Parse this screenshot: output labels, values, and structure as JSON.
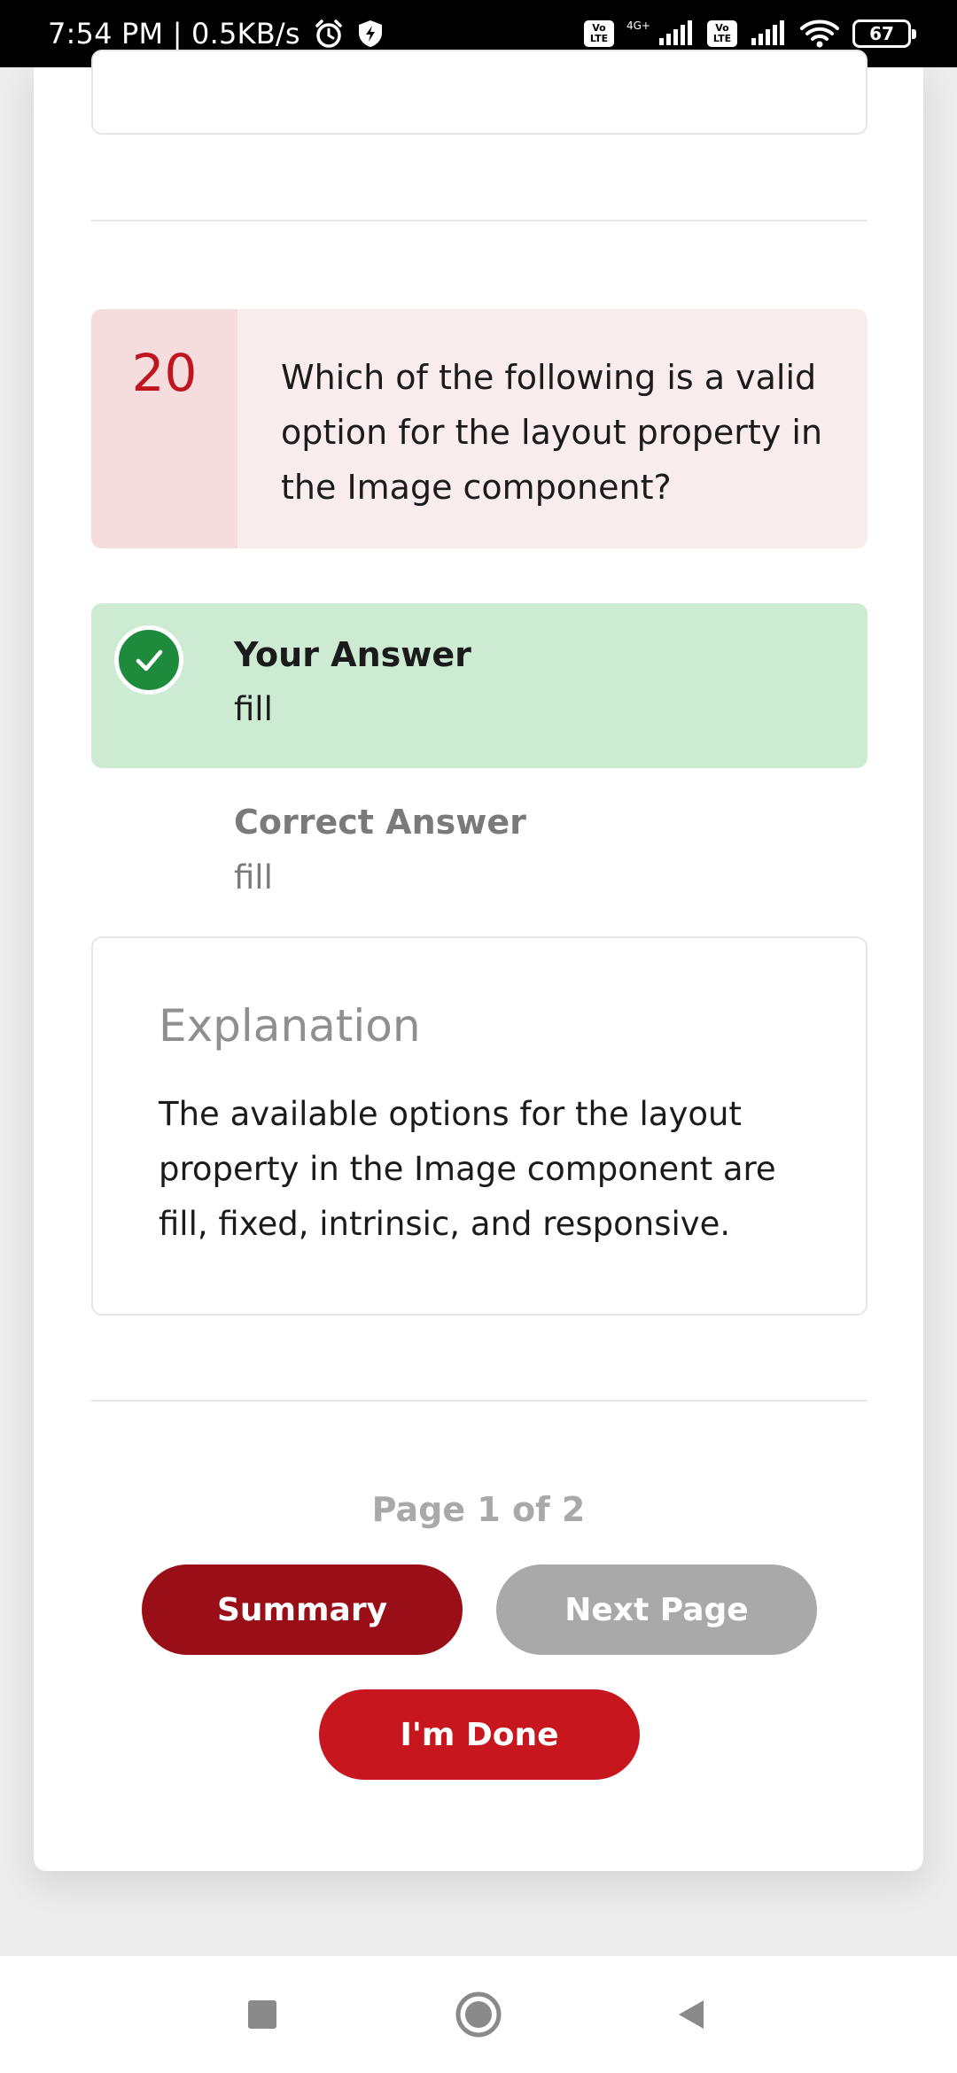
{
  "status_bar": {
    "time_speed": "7:54 PM | 0.5KB/s",
    "volte_1": "Vo\nLTE",
    "net_type": "4G+",
    "volte_2": "Vo\nLTE",
    "battery": "67",
    "icons": [
      "alarm-icon",
      "shield-bolt-icon",
      "signal-icon",
      "wifi-icon"
    ]
  },
  "question": {
    "number": "20",
    "text": "Which of the following is a valid option for the layout property in the Image component?"
  },
  "your_answer": {
    "label": "Your Answer",
    "value": "fill"
  },
  "correct_answer": {
    "label": "Correct Answer",
    "value": "fill"
  },
  "explanation": {
    "title": "Explanation",
    "text": "The available options for the layout property in the Image component are fill, fixed, intrinsic, and responsive."
  },
  "pagination": {
    "page_info": "Page 1 of 2"
  },
  "buttons": {
    "summary": "Summary",
    "next_page": "Next Page",
    "done": "I'm Done"
  },
  "colors": {
    "accent_red": "#c8161e",
    "dark_red": "#9a0f17",
    "correct_green": "#1e8a3c",
    "answer_bg": "#cdebd3",
    "question_bg": "#f9ecec"
  }
}
